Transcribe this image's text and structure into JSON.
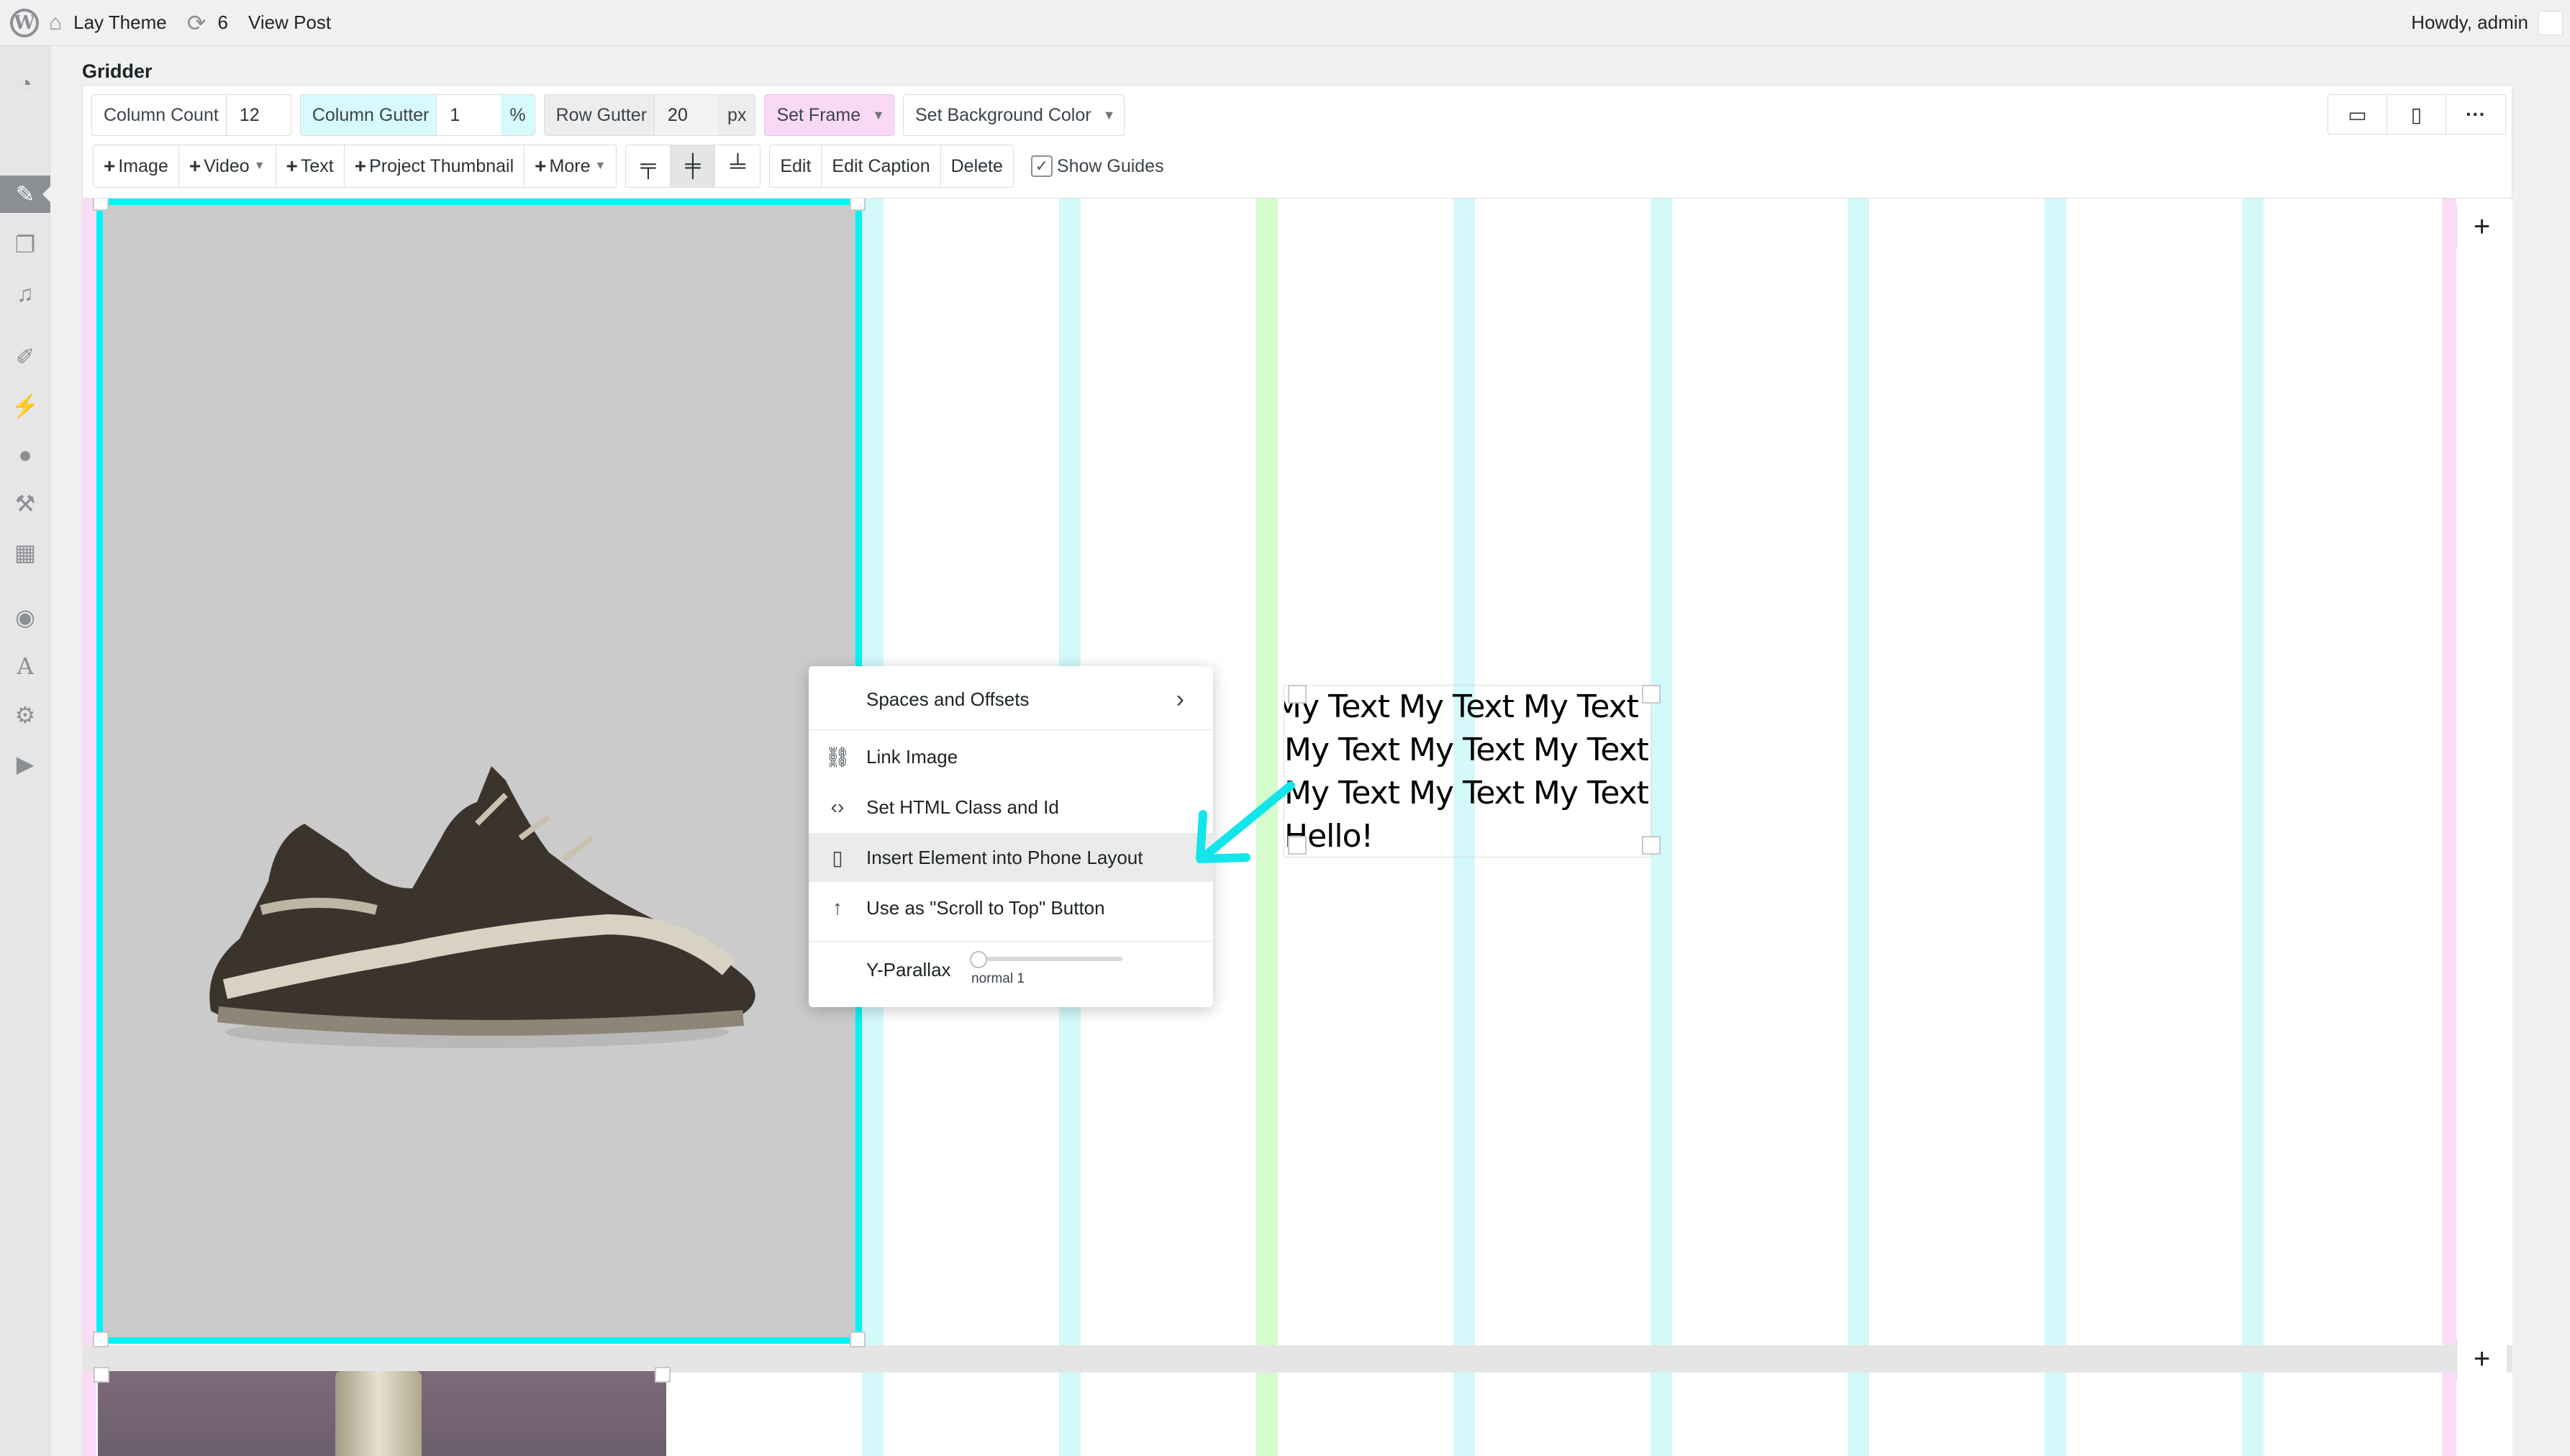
{
  "adminbar": {
    "site_name": "Lay Theme",
    "updates_count": "6",
    "view_post": "View Post",
    "howdy": "Howdy, admin"
  },
  "page": {
    "title": "Gridder"
  },
  "toolbar": {
    "column_count_label": "Column Count",
    "column_count_value": "12",
    "column_gutter_label": "Column Gutter",
    "column_gutter_value": "1",
    "column_gutter_unit": "%",
    "row_gutter_label": "Row Gutter",
    "row_gutter_value": "20",
    "row_gutter_unit": "px",
    "set_frame": "Set Frame",
    "set_background_color": "Set Background Color",
    "add_image": "Image",
    "add_video": "Video",
    "add_text": "Text",
    "add_project_thumbnail": "Project Thumbnail",
    "add_more": "More",
    "edit": "Edit",
    "edit_caption": "Edit Caption",
    "delete": "Delete",
    "show_guides": "Show Guides",
    "show_guides_checked": true
  },
  "text_element": {
    "lines": [
      "My Text My Text My Text",
      "My Text My Text My Text",
      "My Text My Text My Text",
      "Hello!"
    ]
  },
  "context_menu": {
    "items": [
      {
        "label": "Spaces and Offsets",
        "icon": "chevron-right-icon"
      },
      {
        "label": "Link Image",
        "icon": "link-icon"
      },
      {
        "label": "Set HTML Class and Id",
        "icon": "code-icon"
      },
      {
        "label": "Insert Element into Phone Layout",
        "icon": "phone-icon"
      },
      {
        "label": "Use as \"Scroll to Top\" Button",
        "icon": "arrow-up-icon"
      }
    ],
    "y_parallax_label": "Y-Parallax",
    "y_parallax_value": "normal 1"
  },
  "colors": {
    "frame_cyan": "#00f3f5",
    "guide_cyan": "#d3f9fb",
    "guide_green": "#d4fccc",
    "guide_pink": "#fadcf7",
    "annotation_arrow": "#13e6ea"
  }
}
